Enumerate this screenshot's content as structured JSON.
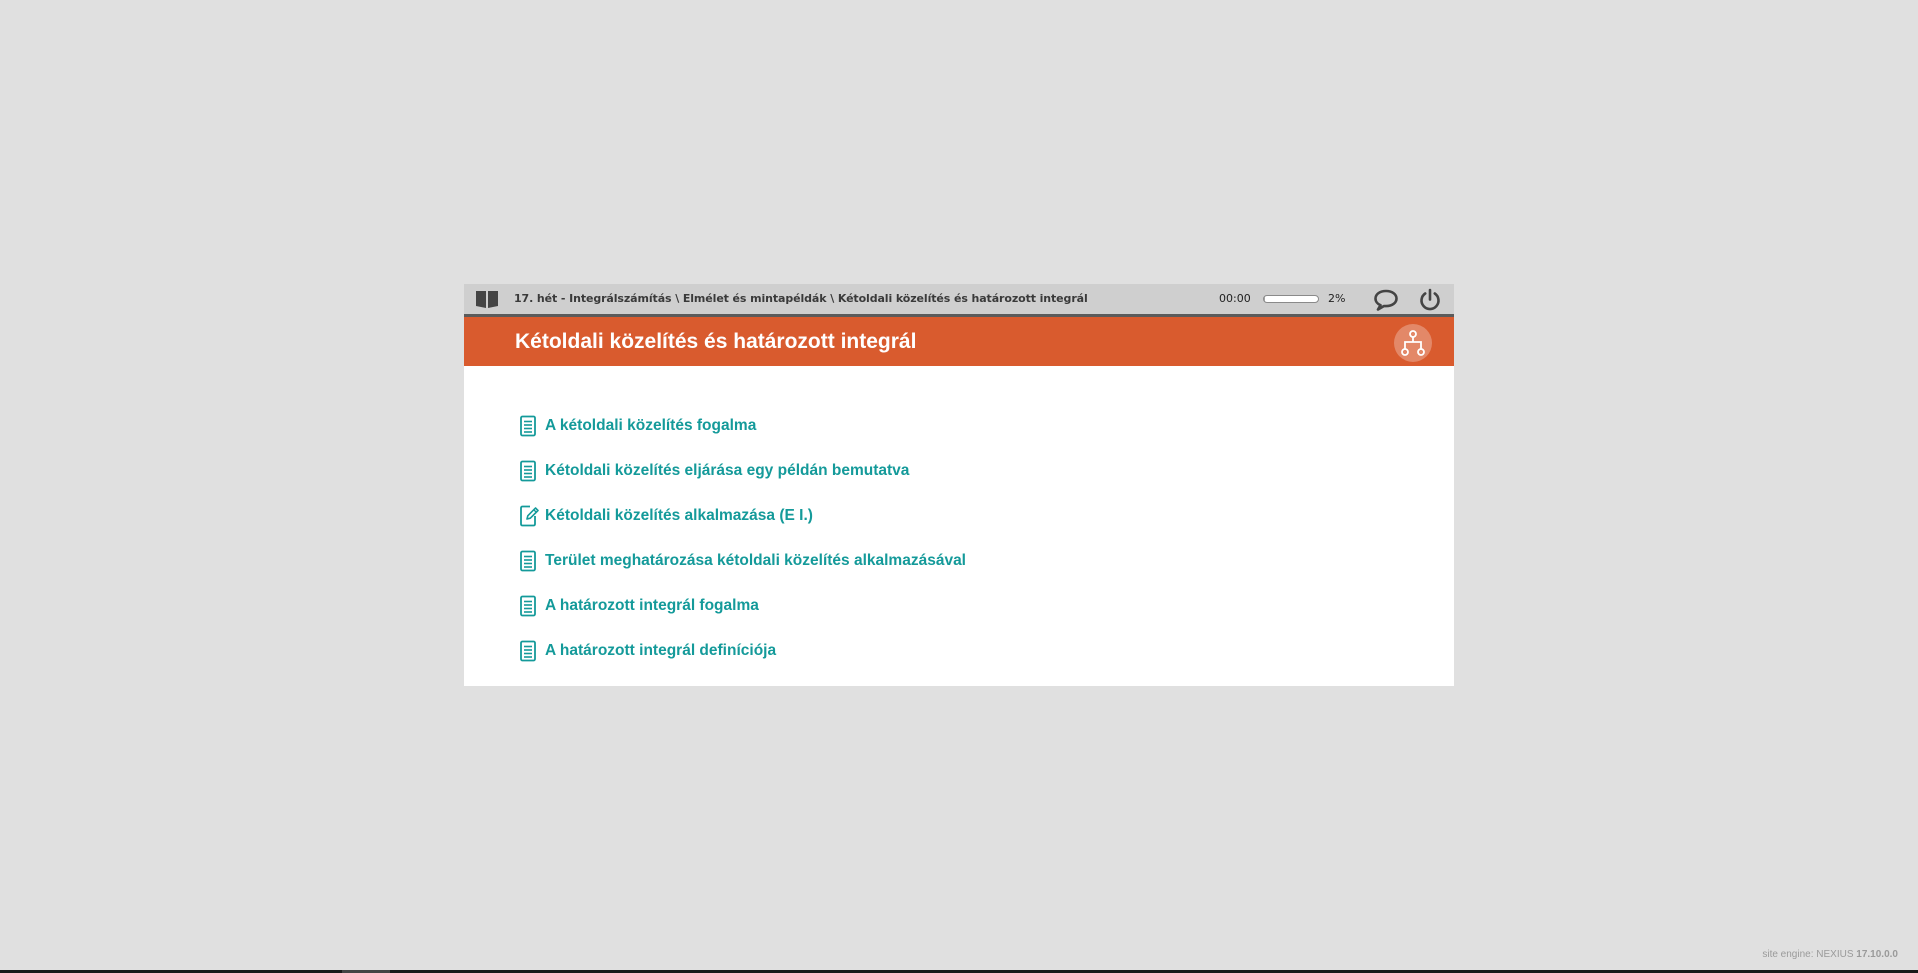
{
  "topbar": {
    "book_icon": "open-book-icon",
    "breadcrumb": "17. hét - Integrálszámítás \\ Elmélet és mintapéldák \\ Kétoldali közelítés és határozott integrál",
    "timer": "00:00",
    "progress": 0.02,
    "percent": "2%",
    "chat_icon": "speech-bubble-icon",
    "power_icon": "power-icon"
  },
  "title_bar": {
    "title": "Kétoldali közelítés és határozott integrál",
    "sitemap_icon": "sitemap-icon"
  },
  "items": [
    {
      "label": "A kétoldali közelítés fogalma",
      "icon": "document-icon"
    },
    {
      "label": "Kétoldali közelítés eljárása egy példán bemutatva",
      "icon": "document-icon"
    },
    {
      "label": "Kétoldali közelítés alkalmazása (E I.)",
      "icon": "edit-document-icon"
    },
    {
      "label": "Terület meghatározása kétoldali közelítés alkalmazásával",
      "icon": "document-icon"
    },
    {
      "label": "A határozott integrál fogalma",
      "icon": "document-icon"
    },
    {
      "label": "A határozott integrál definíciója",
      "icon": "document-icon"
    }
  ],
  "footer": {
    "prefix": "site engine: NEXIUS ",
    "version": "17.10.0.0"
  },
  "colors": {
    "background": "#e0e0e0",
    "accent_orange": "#d95b2e",
    "link_teal": "#149a9a",
    "topbar_gray": "#cfcfcf"
  }
}
